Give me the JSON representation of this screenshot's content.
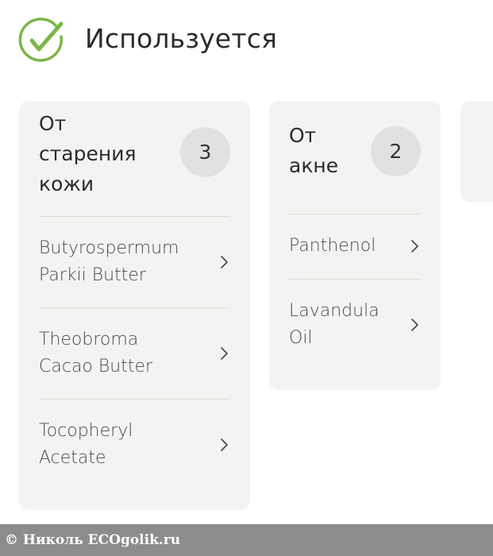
{
  "header": {
    "title": "Используется",
    "icon": "check-circle-icon",
    "icon_color": "#7ab648"
  },
  "cards": [
    {
      "title": "От\nстарения\nкожи",
      "count": "3",
      "items": [
        {
          "label": "Butyrospermum\nParkii Butter"
        },
        {
          "label": "Theobroma\nCacao Butter"
        },
        {
          "label": "Tocopheryl\nAcetate"
        }
      ]
    },
    {
      "title": "От\nакне",
      "count": "2",
      "items": [
        {
          "label": "Panthenol"
        },
        {
          "label": "Lavandula\nOil"
        }
      ]
    }
  ],
  "footer": {
    "text": "© Николь ECOgolik.ru"
  },
  "colors": {
    "card_bg": "#f4f3f1",
    "badge_bg": "#e2e1df",
    "footer_bg": "#8c8c8c"
  }
}
